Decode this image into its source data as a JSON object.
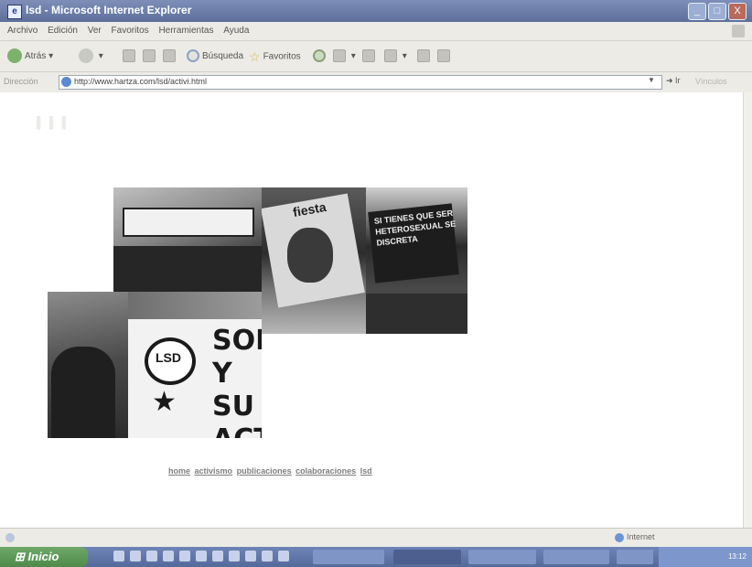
{
  "window": {
    "title": "lsd - Microsoft Internet Explorer",
    "controls": [
      "_",
      "□",
      "X"
    ]
  },
  "menu": [
    "Archivo",
    "Edición",
    "Ver",
    "Favoritos",
    "Herramientas",
    "Ayuda"
  ],
  "toolbar": {
    "back_label": "Atrás",
    "search_label": "Búsqueda",
    "favorites_label": "Favoritos"
  },
  "address": {
    "label": "Dirección",
    "url": "http://www.hartza.com/lsd/activi.html",
    "go_label": "Ir",
    "links_label": "Vínculos"
  },
  "site_nav": {
    "items": [
      "home",
      "activismo",
      "publicaciones",
      "colaboraciones",
      "lsd"
    ]
  },
  "collage": {
    "poster_text": "fiesta",
    "sign_text": "SI TIENES QUE SER HETEROSEXUAL SE DISCRETA",
    "logo_text": "LSD",
    "star": "★",
    "banner_text": "SOM Y SU ACT"
  },
  "statusbar": {
    "zone": "Internet"
  },
  "taskbar": {
    "start_label": "Inicio",
    "tasks": [
      "",
      "",
      "",
      "",
      ""
    ],
    "clock": "13:12"
  },
  "colors": {
    "titlebar": "#5d6f99",
    "chrome": "#ecebe6",
    "link": "#7f7f7f"
  }
}
